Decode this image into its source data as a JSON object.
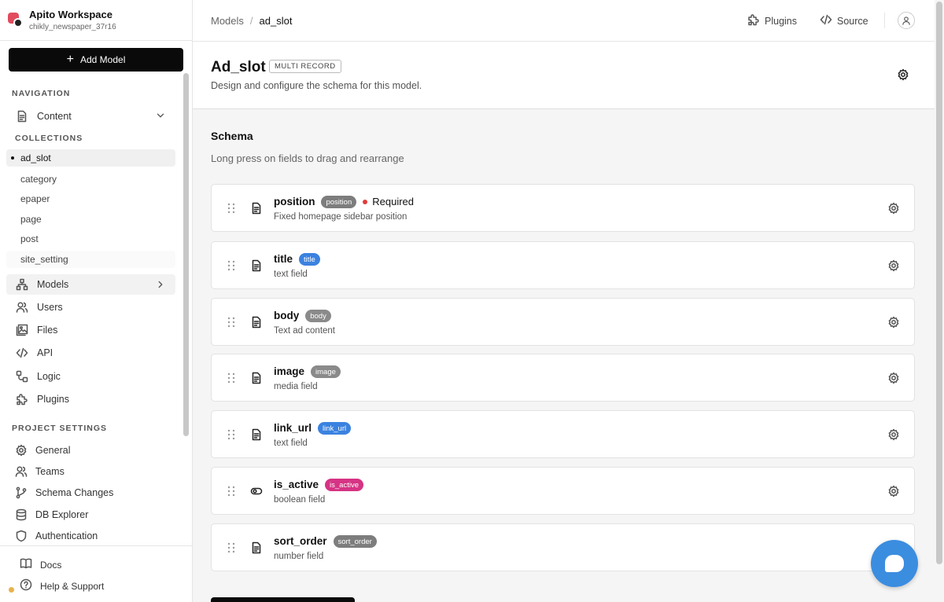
{
  "workspace": {
    "name": "Apito Workspace",
    "project": "chikly_newspaper_37r16"
  },
  "add_model_label": "Add Model",
  "navigation": {
    "heading": "NAVIGATION",
    "content_label": "Content",
    "collections_heading": "COLLECTIONS",
    "collections": [
      "ad_slot",
      "category",
      "epaper",
      "page",
      "post",
      "site_setting"
    ],
    "active_collection": "ad_slot",
    "items": [
      {
        "label": "Models",
        "icon": "models-icon"
      },
      {
        "label": "Users",
        "icon": "users-icon"
      },
      {
        "label": "Files",
        "icon": "files-icon"
      },
      {
        "label": "API",
        "icon": "code-icon"
      },
      {
        "label": "Logic",
        "icon": "logic-icon"
      },
      {
        "label": "Plugins",
        "icon": "puzzle-icon"
      }
    ]
  },
  "project_settings": {
    "heading": "PROJECT SETTINGS",
    "items": [
      {
        "label": "General",
        "icon": "gear-icon"
      },
      {
        "label": "Teams",
        "icon": "users-icon"
      },
      {
        "label": "Schema Changes",
        "icon": "branch-icon"
      },
      {
        "label": "DB Explorer",
        "icon": "database-icon"
      },
      {
        "label": "Authentication",
        "icon": "shield-icon"
      }
    ]
  },
  "footer": {
    "docs": "Docs",
    "help": "Help & Support"
  },
  "breadcrumb": {
    "parent": "Models",
    "separator": "/",
    "current": "ad_slot"
  },
  "topbar": {
    "plugins": "Plugins",
    "source": "Source"
  },
  "header": {
    "title": "Ad_slot",
    "badge": "MULTI RECORD",
    "subtitle": "Design and configure the schema for this model."
  },
  "schema": {
    "title": "Schema",
    "hint": "Long press on fields to drag and rearrange",
    "required_label": "Required",
    "fields": [
      {
        "name": "position",
        "tag": "position",
        "tag_color": "#7d7d7d",
        "desc": "Fixed homepage sidebar position",
        "icon": "document-icon",
        "required": true
      },
      {
        "name": "title",
        "tag": "title",
        "tag_color": "#3b82e0",
        "desc": "text field",
        "icon": "document-icon",
        "required": false
      },
      {
        "name": "body",
        "tag": "body",
        "tag_color": "#8a8a8a",
        "desc": "Text ad content",
        "icon": "document-icon",
        "required": false
      },
      {
        "name": "image",
        "tag": "image",
        "tag_color": "#8a8a8a",
        "desc": "media field",
        "icon": "document-icon",
        "required": false
      },
      {
        "name": "link_url",
        "tag": "link_url",
        "tag_color": "#3b82e0",
        "desc": "text field",
        "icon": "document-icon",
        "required": false
      },
      {
        "name": "is_active",
        "tag": "is_active",
        "tag_color": "#d63384",
        "desc": "boolean field",
        "icon": "toggle-icon",
        "required": false
      },
      {
        "name": "sort_order",
        "tag": "sort_order",
        "tag_color": "#7d7d7d",
        "desc": "number field",
        "icon": "document-icon",
        "required": false
      }
    ]
  }
}
